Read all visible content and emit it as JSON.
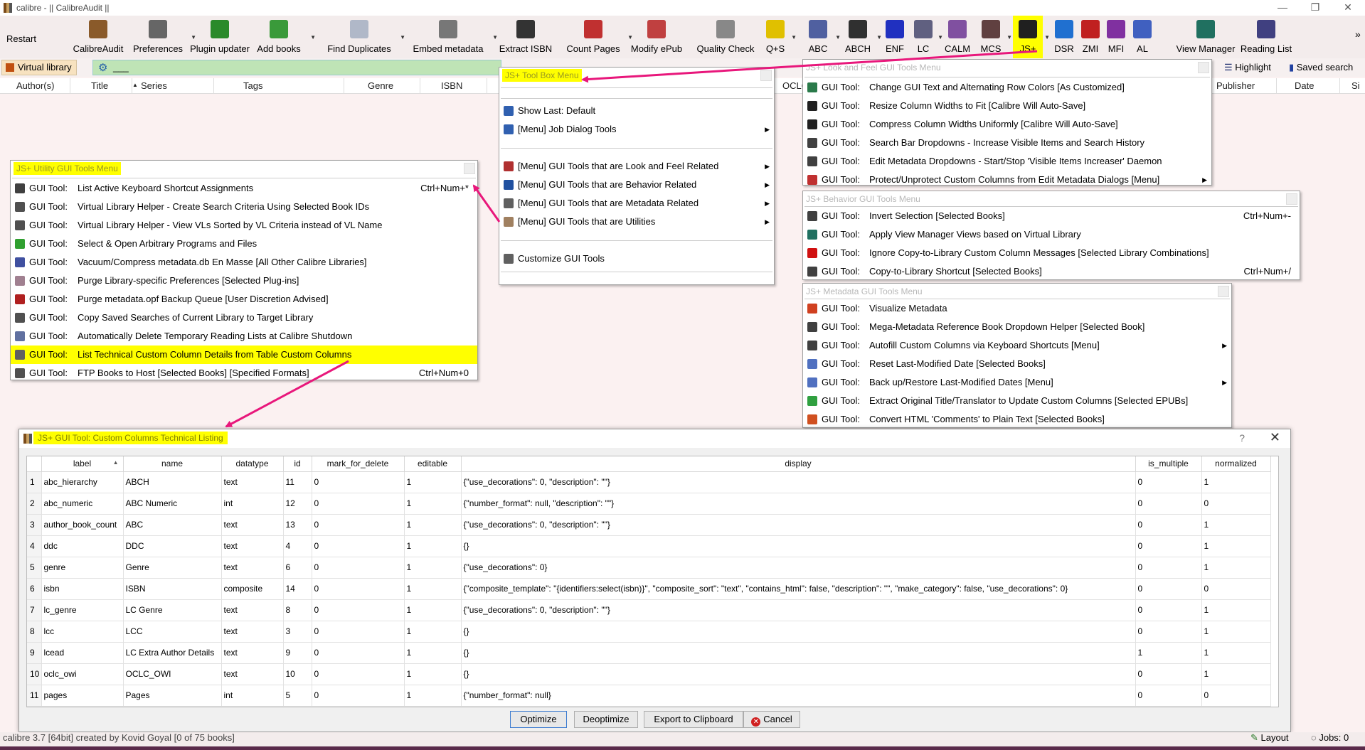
{
  "window": {
    "title": "calibre - || CalibreAudit ||",
    "minimize": "—",
    "restore": "❐",
    "close": "✕"
  },
  "toolbar": [
    {
      "label": "Restart",
      "icon": "restart-icon",
      "color": "#f3ecec"
    },
    {
      "label": "CalibreAudit",
      "icon": "library-icon",
      "color": "#8a5a2a"
    },
    {
      "label": "Preferences",
      "icon": "preferences-icon",
      "color": "#666666"
    },
    {
      "label": "Plugin updater",
      "icon": "plugin-updater-icon",
      "color": "#2a8a2a"
    },
    {
      "label": "Add books",
      "icon": "add-books-icon",
      "color": "#3a9a3a"
    },
    {
      "label": "Find Duplicates",
      "icon": "find-duplicates-icon",
      "color": "#b0b8c8"
    },
    {
      "label": "Embed metadata",
      "icon": "embed-metadata-icon",
      "color": "#777777"
    },
    {
      "label": "Extract ISBN",
      "icon": "extract-isbn-icon",
      "color": "#333333"
    },
    {
      "label": "Count Pages",
      "icon": "count-pages-icon",
      "color": "#c03030"
    },
    {
      "label": "Modify ePub",
      "icon": "modify-epub-icon",
      "color": "#c04040"
    },
    {
      "label": "Quality Check",
      "icon": "quality-check-icon",
      "color": "#888888"
    },
    {
      "label": "Q+S",
      "icon": "q-s-icon",
      "color": "#e0c000"
    },
    {
      "label": "ABC",
      "icon": "abc-icon",
      "color": "#5060a0"
    },
    {
      "label": "ABCH",
      "icon": "abch-icon",
      "color": "#303030"
    },
    {
      "label": "ENF",
      "icon": "enf-icon",
      "color": "#2030c0"
    },
    {
      "label": "LC",
      "icon": "lc-icon",
      "color": "#606080"
    },
    {
      "label": "CALM",
      "icon": "calm-icon",
      "color": "#8050a0"
    },
    {
      "label": "MCS",
      "icon": "mcs-icon",
      "color": "#604040"
    },
    {
      "label": "JS+",
      "icon": "eye-icon",
      "color": "#202020"
    },
    {
      "label": "DSR",
      "icon": "drop-icon",
      "color": "#2070d0"
    },
    {
      "label": "ZMI",
      "icon": "zmi-icon",
      "color": "#c02020"
    },
    {
      "label": "MFI",
      "icon": "mfi-icon",
      "color": "#8030a0"
    },
    {
      "label": "AL",
      "icon": "al-icon",
      "color": "#4060c0"
    },
    {
      "label": "View Manager",
      "icon": "view-manager-icon",
      "color": "#207060"
    },
    {
      "label": "Reading List",
      "icon": "reading-list-icon",
      "color": "#404080"
    }
  ],
  "toolbar_more": "»",
  "search": {
    "virtual_library": "Virtual library",
    "query": "___",
    "highlight": "Highlight",
    "saved_search": "Saved search"
  },
  "columns": [
    "Author(s)",
    "Title",
    "Series",
    "Tags",
    "Genre",
    "ISBN",
    "OCLC",
    "Publisher",
    "Date",
    "Si"
  ],
  "jsplus_menu": {
    "title": "JS+ Tool Box Menu",
    "items": [
      {
        "text": "Show Last: Default",
        "icon": "eye-icon",
        "color": "#3060b0"
      },
      {
        "text": "[Menu] Job Dialog Tools",
        "icon": "eye-icon",
        "color": "#3060b0",
        "submenu": "▶"
      },
      {
        "text": "[Menu] GUI Tools that are Look and Feel Related",
        "icon": "brush-icon",
        "color": "#b03030",
        "submenu": "▶"
      },
      {
        "text": "[Menu] GUI Tools that are Behavior Related",
        "icon": "gear-icon",
        "color": "#2050a0",
        "submenu": "▶"
      },
      {
        "text": "[Menu] GUI Tools that are Metadata Related",
        "icon": "column-icon",
        "color": "#606060",
        "submenu": "▶"
      },
      {
        "text": "[Menu] GUI Tools that are Utilities",
        "icon": "wand-icon",
        "color": "#a08060",
        "submenu": "▶"
      },
      {
        "text": "Customize GUI Tools",
        "icon": "tools-icon",
        "color": "#606060"
      }
    ]
  },
  "utility_menu": {
    "title": "JS+ Utility GUI Tools Menu",
    "prefix": "GUI Tool:",
    "items": [
      {
        "text": "List Active Keyboard Shortcut Assignments",
        "shortcut": "Ctrl+Num+*",
        "icon": "grid-icon",
        "color": "#404040"
      },
      {
        "text": "Virtual Library Helper - Create Search Criteria Using Selected Book IDs",
        "icon": "binoculars-icon",
        "color": "#505050"
      },
      {
        "text": "Virtual Library Helper - View VLs Sorted by VL Criteria instead of VL Name",
        "icon": "binoculars-icon",
        "color": "#505050"
      },
      {
        "text": "Select & Open Arbitrary Programs and Files",
        "icon": "open-icon",
        "color": "#30a030"
      },
      {
        "text": "Vacuum/Compress metadata.db En Masse [All Other Calibre Libraries]",
        "icon": "vacuum-icon",
        "color": "#4050a0"
      },
      {
        "text": "Purge Library-specific Preferences [Selected Plug-ins]",
        "icon": "purge-icon",
        "color": "#a08090"
      },
      {
        "text": "Purge metadata.opf Backup Queue [User Discretion Advised]",
        "icon": "stop-icon",
        "color": "#b02020"
      },
      {
        "text": "Copy Saved Searches of Current Library to Target Library",
        "icon": "binoculars-icon",
        "color": "#505050"
      },
      {
        "text": "Automatically Delete Temporary Reading Lists at Calibre Shutdown",
        "icon": "reading-list-icon",
        "color": "#6070a0"
      },
      {
        "text": "List Technical Custom Column Details from Table Custom Columns",
        "icon": "column-icon",
        "color": "#606060",
        "highlight": true
      },
      {
        "text": "FTP Books to Host [Selected Books] [Specified Formats]",
        "shortcut": "Ctrl+Num+0",
        "icon": "ftp-icon",
        "color": "#505050"
      }
    ]
  },
  "look_menu": {
    "title": "JS+ Look and Feel GUI Tools Menu",
    "prefix": "GUI Tool:",
    "items": [
      {
        "text": "Change GUI Text and Alternating Row Colors [As Customized]",
        "icon": "palette-icon",
        "color": "#2a7a4a"
      },
      {
        "text": "Resize Column Widths to Fit [Calibre Will Auto-Save]",
        "icon": "resize-icon",
        "color": "#202020"
      },
      {
        "text": "Compress Column Widths Uniformly [Calibre Will Auto-Save]",
        "icon": "compress-icon",
        "color": "#202020"
      },
      {
        "text": "Search Bar Dropdowns - Increase Visible Items and Search History",
        "icon": "screen-icon",
        "color": "#404040"
      },
      {
        "text": "Edit Metadata Dropdowns - Start/Stop 'Visible Items Increaser' Daemon",
        "icon": "screen-icon",
        "color": "#404040"
      },
      {
        "text": "Protect/Unprotect Custom Columns from Edit Metadata Dialogs [Menu]",
        "icon": "protect-icon",
        "color": "#c03030",
        "submenu": "▶"
      }
    ]
  },
  "behavior_menu": {
    "title": "JS+ Behavior GUI Tools Menu",
    "prefix": "GUI Tool:",
    "items": [
      {
        "text": "Invert Selection [Selected Books]",
        "shortcut": "Ctrl+Num+-",
        "icon": "grid-icon",
        "color": "#404040"
      },
      {
        "text": "Apply View Manager Views based on Virtual Library",
        "icon": "view-manager-icon",
        "color": "#207060"
      },
      {
        "text": "Ignore Copy-to-Library Custom Column Messages [Selected Library Combinations]",
        "icon": "red-circle-icon",
        "color": "#d01010"
      },
      {
        "text": "Copy-to-Library Shortcut [Selected Books]",
        "shortcut": "Ctrl+Num+/",
        "icon": "grid-icon",
        "color": "#404040"
      }
    ]
  },
  "metadata_menu": {
    "title": "JS+ Metadata GUI Tools Menu",
    "prefix": "GUI Tool:",
    "items": [
      {
        "text": "Visualize Metadata",
        "icon": "pie-chart-icon",
        "color": "#d04020"
      },
      {
        "text": "Mega-Metadata Reference Book Dropdown Helper [Selected Book]",
        "icon": "screen-icon",
        "color": "#404040"
      },
      {
        "text": "Autofill Custom Columns via Keyboard Shortcuts [Menu]",
        "icon": "grid-icon",
        "color": "#404040",
        "submenu": "▶"
      },
      {
        "text": "Reset Last-Modified Date [Selected Books]",
        "icon": "book-icon",
        "color": "#5070c0"
      },
      {
        "text": "Back up/Restore Last-Modified Dates [Menu]",
        "icon": "book-icon",
        "color": "#5070c0",
        "submenu": "▶"
      },
      {
        "text": "Extract Original Title/Translator to Update Custom Columns [Selected EPUBs]",
        "icon": "globe-icon",
        "color": "#30a040"
      },
      {
        "text": "Convert HTML 'Comments' to Plain Text [Selected Books]",
        "icon": "html-icon",
        "color": "#d05020"
      }
    ]
  },
  "dialog": {
    "title": "JS+ GUI Tool:  Custom Columns Technical Listing",
    "help": "?",
    "close": "✕",
    "headers": [
      "label",
      "name",
      "datatype",
      "id",
      "mark_for_delete",
      "editable",
      "display",
      "is_multiple",
      "normalized"
    ],
    "rows": [
      [
        "1",
        "abc_hierarchy",
        "ABCH",
        "text",
        "11",
        "0",
        "1",
        "{\"use_decorations\": 0, \"description\": \"\"}",
        "0",
        "1"
      ],
      [
        "2",
        "abc_numeric",
        "ABC Numeric",
        "int",
        "12",
        "0",
        "1",
        "{\"number_format\": null, \"description\": \"\"}",
        "0",
        "0"
      ],
      [
        "3",
        "author_book_count",
        "ABC",
        "text",
        "13",
        "0",
        "1",
        "{\"use_decorations\": 0, \"description\": \"\"}",
        "0",
        "1"
      ],
      [
        "4",
        "ddc",
        "DDC",
        "text",
        "4",
        "0",
        "1",
        "{}",
        "0",
        "1"
      ],
      [
        "5",
        "genre",
        "Genre",
        "text",
        "6",
        "0",
        "1",
        "{\"use_decorations\": 0}",
        "0",
        "1"
      ],
      [
        "6",
        "isbn",
        "ISBN",
        "composite",
        "14",
        "0",
        "1",
        "{\"composite_template\": \"{identifiers:select(isbn)}\", \"composite_sort\": \"text\", \"contains_html\": false, \"description\": \"\", \"make_category\": false, \"use_decorations\": 0}",
        "0",
        "0"
      ],
      [
        "7",
        "lc_genre",
        "LC Genre",
        "text",
        "8",
        "0",
        "1",
        "{\"use_decorations\": 0, \"description\": \"\"}",
        "0",
        "1"
      ],
      [
        "8",
        "lcc",
        "LCC",
        "text",
        "3",
        "0",
        "1",
        "{}",
        "0",
        "1"
      ],
      [
        "9",
        "lcead",
        "LC Extra Author Details",
        "text",
        "9",
        "0",
        "1",
        "{}",
        "1",
        "1"
      ],
      [
        "10",
        "oclc_owi",
        "OCLC_OWI",
        "text",
        "10",
        "0",
        "1",
        "{}",
        "0",
        "1"
      ],
      [
        "11",
        "pages",
        "Pages",
        "int",
        "5",
        "0",
        "1",
        "{\"number_format\": null}",
        "0",
        "0"
      ]
    ],
    "buttons": {
      "optimize": "Optimize",
      "deoptimize": "Deoptimize",
      "export": "Export to Clipboard",
      "cancel": "Cancel"
    }
  },
  "status": {
    "text": "calibre 3.7 [64bit] created by Kovid Goyal    [0 of 75 books]",
    "layout": "Layout",
    "jobs": "Jobs: 0"
  },
  "annotation_color": "#e8177b",
  "highlight_color": "#ffff00"
}
